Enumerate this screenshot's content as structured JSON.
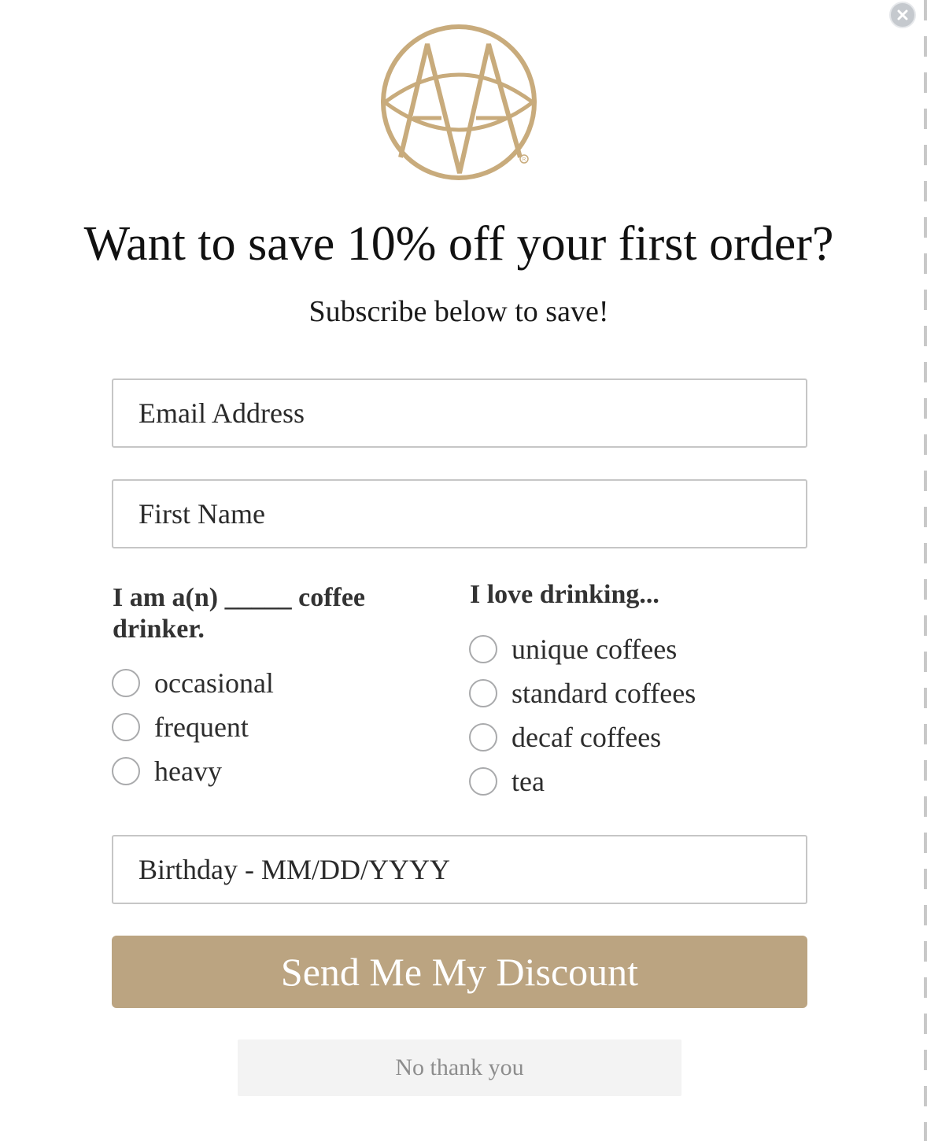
{
  "popup": {
    "close_icon": "close-icon",
    "logo_icon": "monogram-logo-icon",
    "headline": "Want to save 10% off your first order?",
    "subhead": "Subscribe below to save!"
  },
  "form": {
    "email_placeholder": "Email Address",
    "first_name_placeholder": "First Name",
    "drinker_group": {
      "label": "I am a(n) _____ coffee drinker.",
      "options": [
        "occasional",
        "frequent",
        "heavy"
      ]
    },
    "drinking_group": {
      "label": "I love drinking...",
      "options": [
        "unique coffees",
        "standard coffees",
        "decaf coffees",
        "tea"
      ]
    },
    "birthday_placeholder": "Birthday - MM/DD/YYYY",
    "submit_label": "Send Me My Discount",
    "decline_label": "No thank you"
  },
  "colors": {
    "brand_gold": "#bba481",
    "logo_gold": "#c8ab7c",
    "close_grey": "#c5c9ce"
  }
}
